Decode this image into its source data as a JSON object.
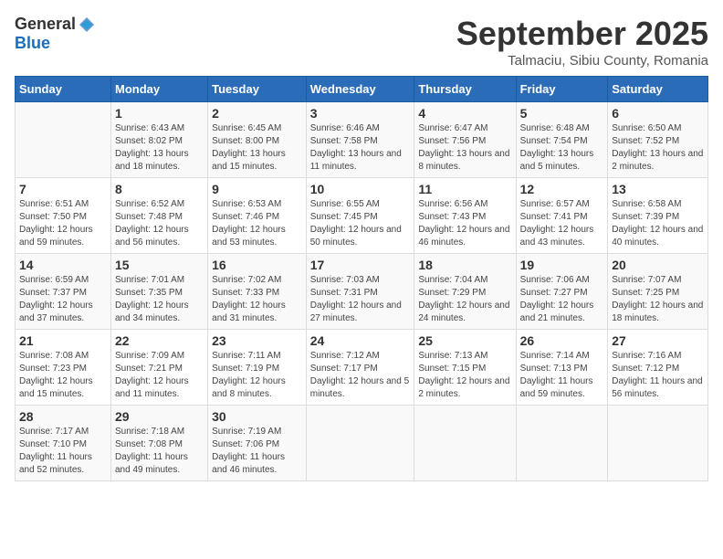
{
  "logo": {
    "general": "General",
    "blue": "Blue"
  },
  "title": "September 2025",
  "location": "Talmaciu, Sibiu County, Romania",
  "days_of_week": [
    "Sunday",
    "Monday",
    "Tuesday",
    "Wednesday",
    "Thursday",
    "Friday",
    "Saturday"
  ],
  "weeks": [
    [
      {
        "day": "",
        "sunrise": "",
        "sunset": "",
        "daylight": ""
      },
      {
        "day": "1",
        "sunrise": "Sunrise: 6:43 AM",
        "sunset": "Sunset: 8:02 PM",
        "daylight": "Daylight: 13 hours and 18 minutes."
      },
      {
        "day": "2",
        "sunrise": "Sunrise: 6:45 AM",
        "sunset": "Sunset: 8:00 PM",
        "daylight": "Daylight: 13 hours and 15 minutes."
      },
      {
        "day": "3",
        "sunrise": "Sunrise: 6:46 AM",
        "sunset": "Sunset: 7:58 PM",
        "daylight": "Daylight: 13 hours and 11 minutes."
      },
      {
        "day": "4",
        "sunrise": "Sunrise: 6:47 AM",
        "sunset": "Sunset: 7:56 PM",
        "daylight": "Daylight: 13 hours and 8 minutes."
      },
      {
        "day": "5",
        "sunrise": "Sunrise: 6:48 AM",
        "sunset": "Sunset: 7:54 PM",
        "daylight": "Daylight: 13 hours and 5 minutes."
      },
      {
        "day": "6",
        "sunrise": "Sunrise: 6:50 AM",
        "sunset": "Sunset: 7:52 PM",
        "daylight": "Daylight: 13 hours and 2 minutes."
      }
    ],
    [
      {
        "day": "7",
        "sunrise": "Sunrise: 6:51 AM",
        "sunset": "Sunset: 7:50 PM",
        "daylight": "Daylight: 12 hours and 59 minutes."
      },
      {
        "day": "8",
        "sunrise": "Sunrise: 6:52 AM",
        "sunset": "Sunset: 7:48 PM",
        "daylight": "Daylight: 12 hours and 56 minutes."
      },
      {
        "day": "9",
        "sunrise": "Sunrise: 6:53 AM",
        "sunset": "Sunset: 7:46 PM",
        "daylight": "Daylight: 12 hours and 53 minutes."
      },
      {
        "day": "10",
        "sunrise": "Sunrise: 6:55 AM",
        "sunset": "Sunset: 7:45 PM",
        "daylight": "Daylight: 12 hours and 50 minutes."
      },
      {
        "day": "11",
        "sunrise": "Sunrise: 6:56 AM",
        "sunset": "Sunset: 7:43 PM",
        "daylight": "Daylight: 12 hours and 46 minutes."
      },
      {
        "day": "12",
        "sunrise": "Sunrise: 6:57 AM",
        "sunset": "Sunset: 7:41 PM",
        "daylight": "Daylight: 12 hours and 43 minutes."
      },
      {
        "day": "13",
        "sunrise": "Sunrise: 6:58 AM",
        "sunset": "Sunset: 7:39 PM",
        "daylight": "Daylight: 12 hours and 40 minutes."
      }
    ],
    [
      {
        "day": "14",
        "sunrise": "Sunrise: 6:59 AM",
        "sunset": "Sunset: 7:37 PM",
        "daylight": "Daylight: 12 hours and 37 minutes."
      },
      {
        "day": "15",
        "sunrise": "Sunrise: 7:01 AM",
        "sunset": "Sunset: 7:35 PM",
        "daylight": "Daylight: 12 hours and 34 minutes."
      },
      {
        "day": "16",
        "sunrise": "Sunrise: 7:02 AM",
        "sunset": "Sunset: 7:33 PM",
        "daylight": "Daylight: 12 hours and 31 minutes."
      },
      {
        "day": "17",
        "sunrise": "Sunrise: 7:03 AM",
        "sunset": "Sunset: 7:31 PM",
        "daylight": "Daylight: 12 hours and 27 minutes."
      },
      {
        "day": "18",
        "sunrise": "Sunrise: 7:04 AM",
        "sunset": "Sunset: 7:29 PM",
        "daylight": "Daylight: 12 hours and 24 minutes."
      },
      {
        "day": "19",
        "sunrise": "Sunrise: 7:06 AM",
        "sunset": "Sunset: 7:27 PM",
        "daylight": "Daylight: 12 hours and 21 minutes."
      },
      {
        "day": "20",
        "sunrise": "Sunrise: 7:07 AM",
        "sunset": "Sunset: 7:25 PM",
        "daylight": "Daylight: 12 hours and 18 minutes."
      }
    ],
    [
      {
        "day": "21",
        "sunrise": "Sunrise: 7:08 AM",
        "sunset": "Sunset: 7:23 PM",
        "daylight": "Daylight: 12 hours and 15 minutes."
      },
      {
        "day": "22",
        "sunrise": "Sunrise: 7:09 AM",
        "sunset": "Sunset: 7:21 PM",
        "daylight": "Daylight: 12 hours and 11 minutes."
      },
      {
        "day": "23",
        "sunrise": "Sunrise: 7:11 AM",
        "sunset": "Sunset: 7:19 PM",
        "daylight": "Daylight: 12 hours and 8 minutes."
      },
      {
        "day": "24",
        "sunrise": "Sunrise: 7:12 AM",
        "sunset": "Sunset: 7:17 PM",
        "daylight": "Daylight: 12 hours and 5 minutes."
      },
      {
        "day": "25",
        "sunrise": "Sunrise: 7:13 AM",
        "sunset": "Sunset: 7:15 PM",
        "daylight": "Daylight: 12 hours and 2 minutes."
      },
      {
        "day": "26",
        "sunrise": "Sunrise: 7:14 AM",
        "sunset": "Sunset: 7:13 PM",
        "daylight": "Daylight: 11 hours and 59 minutes."
      },
      {
        "day": "27",
        "sunrise": "Sunrise: 7:16 AM",
        "sunset": "Sunset: 7:12 PM",
        "daylight": "Daylight: 11 hours and 56 minutes."
      }
    ],
    [
      {
        "day": "28",
        "sunrise": "Sunrise: 7:17 AM",
        "sunset": "Sunset: 7:10 PM",
        "daylight": "Daylight: 11 hours and 52 minutes."
      },
      {
        "day": "29",
        "sunrise": "Sunrise: 7:18 AM",
        "sunset": "Sunset: 7:08 PM",
        "daylight": "Daylight: 11 hours and 49 minutes."
      },
      {
        "day": "30",
        "sunrise": "Sunrise: 7:19 AM",
        "sunset": "Sunset: 7:06 PM",
        "daylight": "Daylight: 11 hours and 46 minutes."
      },
      {
        "day": "",
        "sunrise": "",
        "sunset": "",
        "daylight": ""
      },
      {
        "day": "",
        "sunrise": "",
        "sunset": "",
        "daylight": ""
      },
      {
        "day": "",
        "sunrise": "",
        "sunset": "",
        "daylight": ""
      },
      {
        "day": "",
        "sunrise": "",
        "sunset": "",
        "daylight": ""
      }
    ]
  ]
}
